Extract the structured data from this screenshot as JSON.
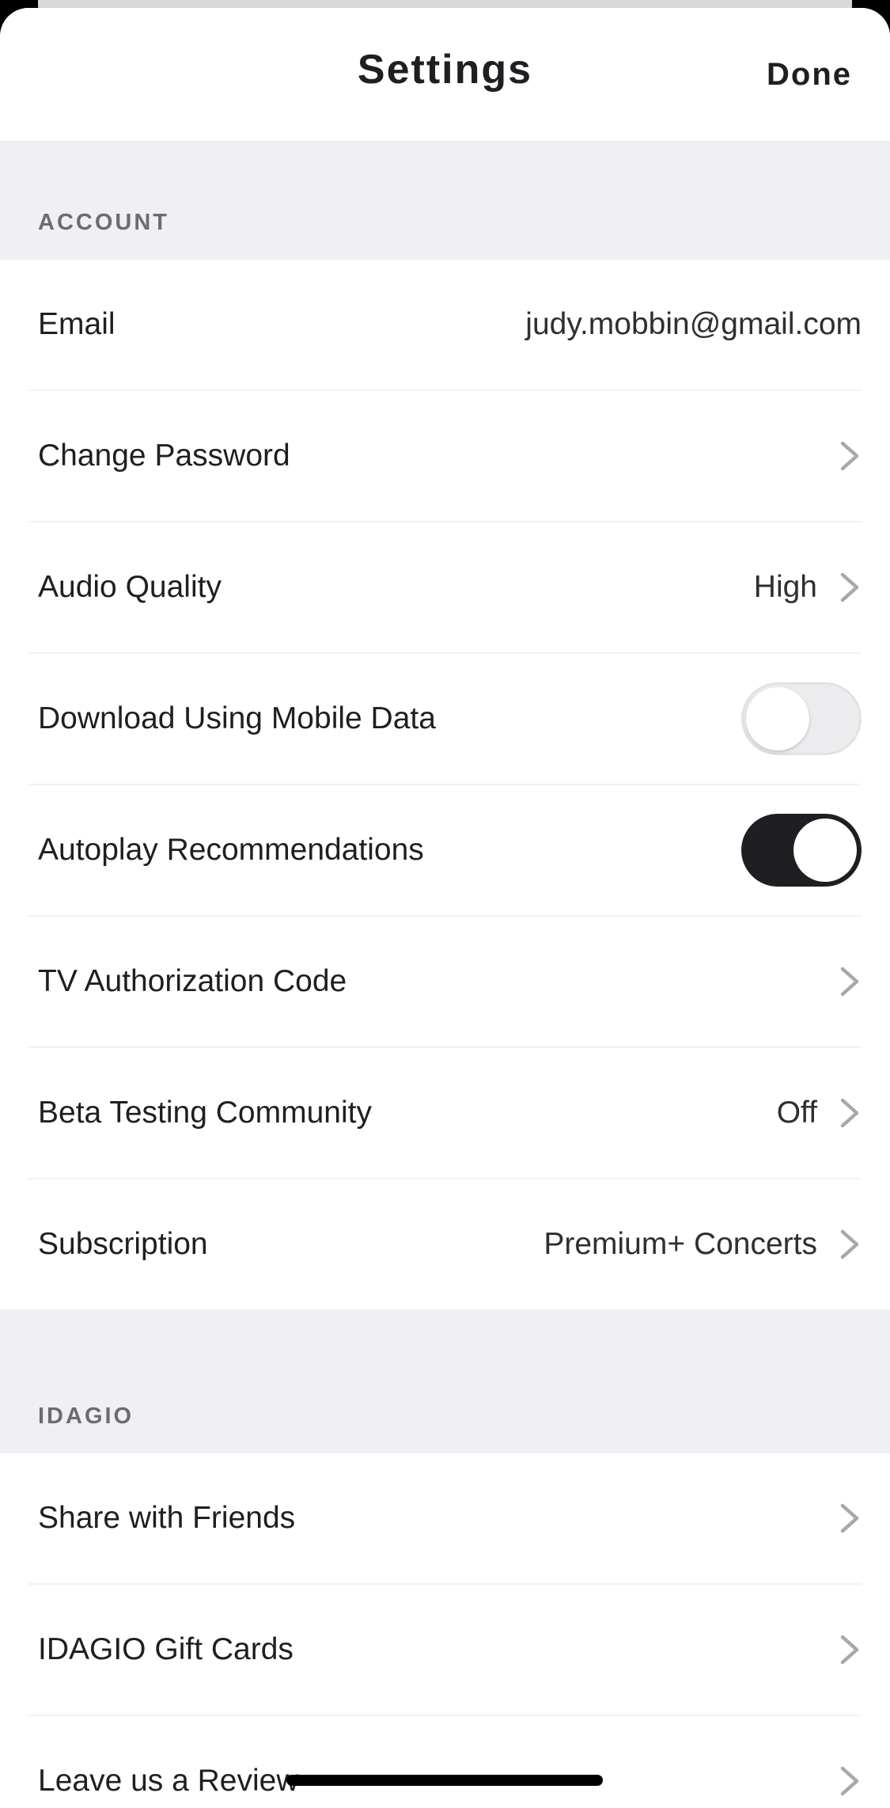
{
  "header": {
    "title": "Settings",
    "done_label": "Done"
  },
  "sections": {
    "account": {
      "title": "ACCOUNT",
      "rows": {
        "email": {
          "label": "Email",
          "value": "judy.mobbin@gmail.com"
        },
        "change_password": {
          "label": "Change Password"
        },
        "audio_quality": {
          "label": "Audio Quality",
          "value": "High"
        },
        "download_mobile": {
          "label": "Download Using Mobile Data",
          "toggle": false
        },
        "autoplay": {
          "label": "Autoplay Recommendations",
          "toggle": true
        },
        "tv_auth": {
          "label": "TV Authorization Code"
        },
        "beta": {
          "label": "Beta Testing Community",
          "value": "Off"
        },
        "subscription": {
          "label": "Subscription",
          "value": "Premium+ Concerts"
        }
      }
    },
    "idagio": {
      "title": "IDAGIO",
      "rows": {
        "share": {
          "label": "Share with Friends"
        },
        "gift_cards": {
          "label": "IDAGIO Gift Cards"
        },
        "review": {
          "label": "Leave us a Review"
        }
      }
    }
  },
  "icons": {
    "chevron": "chevron-right-icon"
  },
  "colors": {
    "text": "#1f1f23",
    "section_bg": "#f0f0f4",
    "toggle_on": "#1f1f23",
    "toggle_off": "#ececee",
    "chevron": "#a7a8ad"
  }
}
